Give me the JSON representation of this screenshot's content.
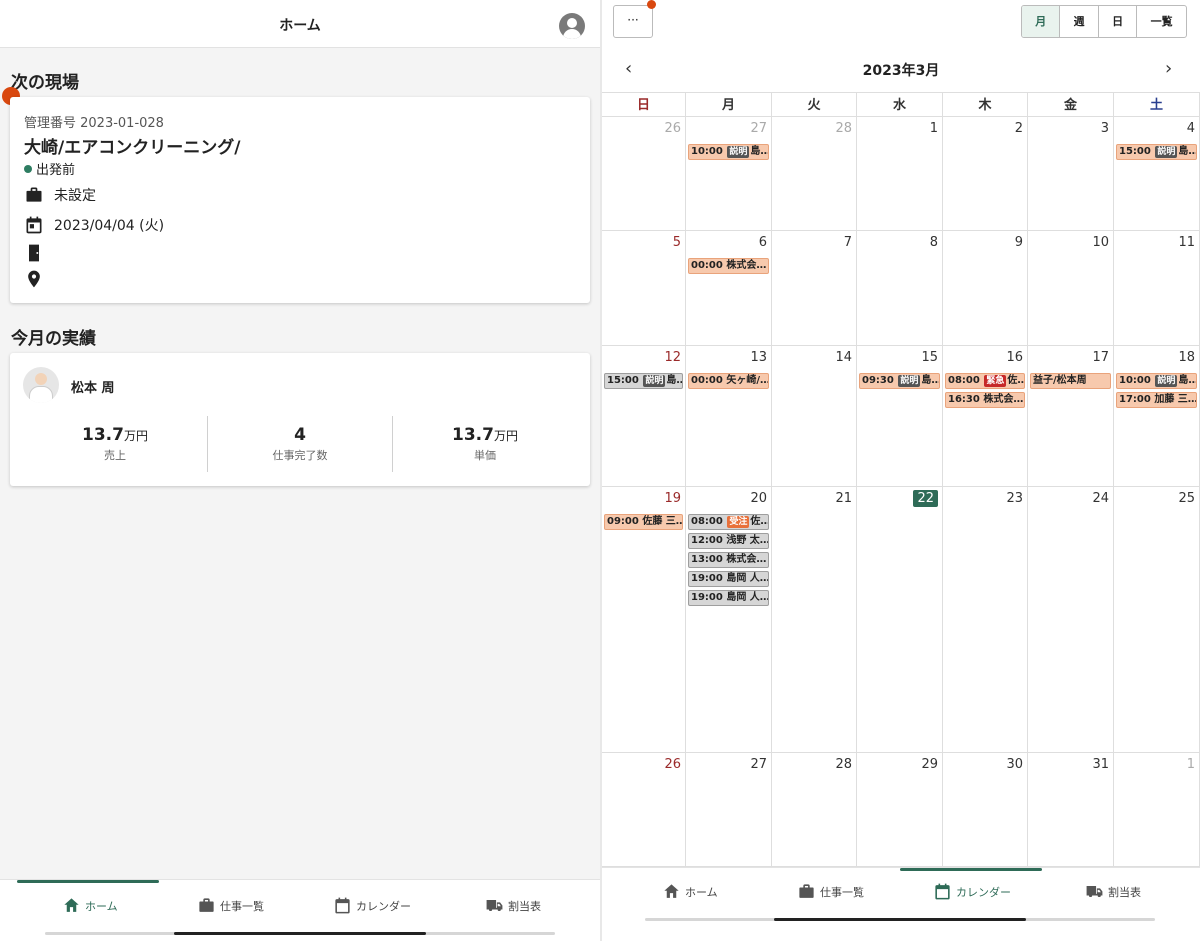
{
  "home": {
    "header_title": "ホーム",
    "next_site": {
      "section_title": "次の現場",
      "management_no": "管理番号 2023-01-028",
      "job_title": "大崎/エアコンクリーニング/",
      "status": "出発前",
      "category": "未設定",
      "date": "2023/04/04 (火)",
      "building": "",
      "location": ""
    },
    "monthly": {
      "section_title": "今月の実績",
      "user_name": "松本 周",
      "stats": [
        {
          "value": "13.7",
          "unit": "万円",
          "label": "売上"
        },
        {
          "value": "4",
          "unit": "",
          "label": "仕事完了数"
        },
        {
          "value": "13.7",
          "unit": "万円",
          "label": "単価"
        }
      ]
    }
  },
  "nav": {
    "items": [
      {
        "label": "ホーム",
        "icon": "home-icon"
      },
      {
        "label": "仕事一覧",
        "icon": "briefcase-icon"
      },
      {
        "label": "カレンダー",
        "icon": "calendar-icon"
      },
      {
        "label": "割当表",
        "icon": "truck-icon"
      }
    ]
  },
  "calendar": {
    "more_label": "···",
    "views": [
      "月",
      "週",
      "日",
      "一覧"
    ],
    "month_title": "2023年3月",
    "prev": "‹",
    "next": "›",
    "weekdays": [
      "日",
      "月",
      "火",
      "水",
      "木",
      "金",
      "土"
    ],
    "weekday_colors": [
      "#9a2a2a",
      "#333333",
      "#333333",
      "#333333",
      "#333333",
      "#333333",
      "#2a3f8f"
    ],
    "today": "22",
    "weeks": [
      [
        {
          "day": "26",
          "other": true,
          "events": []
        },
        {
          "day": "27",
          "other": true,
          "events": [
            {
              "time": "10:00",
              "tag": "説明",
              "tagc": "t-dark",
              "text": "島…",
              "c": "o"
            }
          ]
        },
        {
          "day": "28",
          "other": true,
          "events": []
        },
        {
          "day": "1",
          "events": []
        },
        {
          "day": "2",
          "events": []
        },
        {
          "day": "3",
          "events": []
        },
        {
          "day": "4",
          "events": [
            {
              "time": "15:00",
              "tag": "説明",
              "tagc": "t-dark",
              "text": "島…",
              "c": "o"
            }
          ]
        }
      ],
      [
        {
          "day": "5",
          "events": []
        },
        {
          "day": "6",
          "events": [
            {
              "time": "00:00",
              "tag": "",
              "text": "株式会…",
              "c": "o"
            }
          ]
        },
        {
          "day": "7",
          "events": []
        },
        {
          "day": "8",
          "events": []
        },
        {
          "day": "9",
          "events": []
        },
        {
          "day": "10",
          "events": []
        },
        {
          "day": "11",
          "events": []
        }
      ],
      [
        {
          "day": "12",
          "events": [
            {
              "time": "15:00",
              "tag": "説明",
              "tagc": "t-dark",
              "text": "島…",
              "c": "g"
            }
          ]
        },
        {
          "day": "13",
          "events": [
            {
              "time": "00:00",
              "tag": "",
              "text": "矢ヶ崎/…",
              "c": "o"
            }
          ]
        },
        {
          "day": "14",
          "events": []
        },
        {
          "day": "15",
          "events": [
            {
              "time": "09:30",
              "tag": "説明",
              "tagc": "t-dark",
              "text": "島…",
              "c": "o"
            }
          ]
        },
        {
          "day": "16",
          "events": [
            {
              "time": "08:00",
              "tag": "緊急",
              "tagc": "t-red",
              "text": "佐…",
              "c": "o"
            },
            {
              "time": "16:30",
              "tag": "",
              "text": "株式会…",
              "c": "o"
            }
          ]
        },
        {
          "day": "17",
          "events": [
            {
              "time": "",
              "tag": "",
              "text": "益子/松本周",
              "c": "o"
            }
          ]
        },
        {
          "day": "18",
          "events": [
            {
              "time": "10:00",
              "tag": "説明",
              "tagc": "t-dark",
              "text": "島…",
              "c": "o"
            },
            {
              "time": "17:00",
              "tag": "",
              "text": "加藤 三…",
              "c": "o"
            }
          ]
        }
      ],
      [
        {
          "day": "19",
          "events": [
            {
              "time": "09:00",
              "tag": "",
              "text": "佐藤 三…",
              "c": "o"
            }
          ]
        },
        {
          "day": "20",
          "events": [
            {
              "time": "08:00",
              "tag": "受注",
              "tagc": "t-org",
              "text": "佐…",
              "c": "g"
            },
            {
              "time": "12:00",
              "tag": "",
              "text": "浅野 太…",
              "c": "g"
            },
            {
              "time": "13:00",
              "tag": "",
              "text": "株式会…",
              "c": "g"
            },
            {
              "time": "19:00",
              "tag": "",
              "text": "島岡 人…",
              "c": "g"
            },
            {
              "time": "19:00",
              "tag": "",
              "text": "島岡 人…",
              "c": "g"
            }
          ]
        },
        {
          "day": "21",
          "events": []
        },
        {
          "day": "22",
          "events": []
        },
        {
          "day": "23",
          "events": []
        },
        {
          "day": "24",
          "events": []
        },
        {
          "day": "25",
          "events": []
        }
      ],
      [
        {
          "day": "26",
          "events": []
        },
        {
          "day": "27",
          "events": []
        },
        {
          "day": "28",
          "events": []
        },
        {
          "day": "29",
          "events": []
        },
        {
          "day": "30",
          "events": []
        },
        {
          "day": "31",
          "events": []
        },
        {
          "day": "1",
          "other": true,
          "events": []
        }
      ]
    ]
  }
}
